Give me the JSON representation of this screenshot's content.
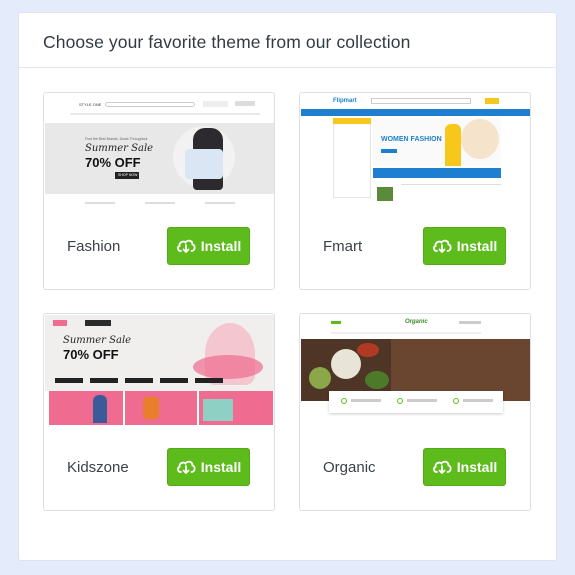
{
  "title": "Choose your favorite theme from our collection",
  "install_label": "Install",
  "themes": [
    {
      "name": "Fashion",
      "preview": {
        "logo": "STYLE ONE",
        "tagline": "Find the Best Brands. Deals Throughout",
        "headline": "Summer Sale",
        "discount": "70% OFF",
        "cta": "SHOP NOW"
      }
    },
    {
      "name": "Fmart",
      "preview": {
        "logo": "Flipmart",
        "headline": "WOMEN FASHION"
      }
    },
    {
      "name": "Kidszone",
      "preview": {
        "headline": "Summer Sale",
        "discount": "70% OFF"
      }
    },
    {
      "name": "Organic",
      "preview": {
        "logo": "Organic"
      }
    }
  ],
  "colors": {
    "background": "#e4ebfb",
    "install": "#5dbb1c",
    "fmart_blue": "#1e7fd1",
    "fmart_yellow": "#f7c71b",
    "kids_pink": "#ef6b8f",
    "organic_green": "#5dbb1c"
  },
  "icons": {
    "install": "cloud-download-icon"
  }
}
